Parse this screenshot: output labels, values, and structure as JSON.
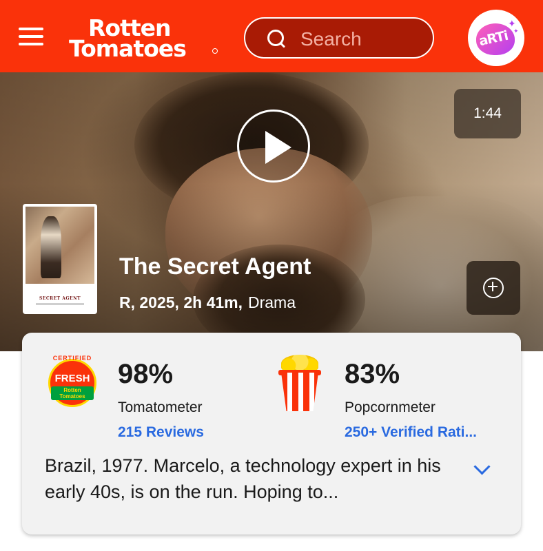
{
  "header": {
    "menu_icon": "hamburger-menu-icon",
    "logo": {
      "line1": "Rotten",
      "line2": "Tomatoes"
    },
    "search": {
      "placeholder": "Search",
      "icon": "search-icon"
    },
    "avatar": {
      "text": "aRTi"
    },
    "brand_color": "#fa320a"
  },
  "hero": {
    "video_duration": "1:44",
    "play_icon": "play-icon",
    "add_icon": "plus-circle-icon",
    "poster": {
      "title": "SECRET AGENT"
    },
    "title": "The Secret Agent",
    "rating_year_runtime": "R, 2025, 2h 41m,",
    "genre": "Drama"
  },
  "scores": {
    "tomatometer": {
      "badge": {
        "top": "CERTIFIED",
        "middle": "FRESH",
        "bottom": "Rotten Tomatoes"
      },
      "percent": "98%",
      "label": "Tomatometer",
      "link": "215 Reviews"
    },
    "popcornmeter": {
      "icon": "popcorn-icon",
      "percent": "83%",
      "label": "Popcornmeter",
      "link": "250+ Verified Rati..."
    },
    "link_color": "#2a6ae0"
  },
  "synopsis": {
    "text": "Brazil, 1977. Marcelo, a technology expert in his early 40s, is on the run. Hoping to...",
    "expand_icon": "chevron-down-icon"
  }
}
